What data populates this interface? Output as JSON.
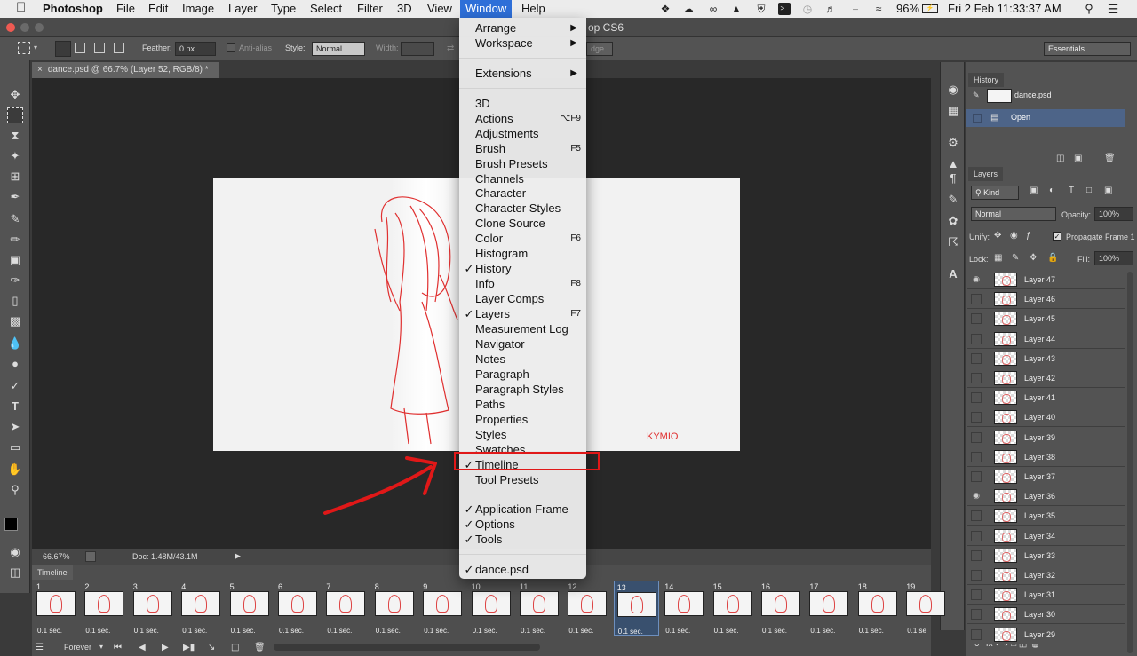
{
  "menubar": {
    "app_name": "Photoshop",
    "items": [
      "File",
      "Edit",
      "Image",
      "Layer",
      "Type",
      "Select",
      "Filter",
      "3D",
      "View",
      "Window",
      "Help"
    ],
    "active": "Window",
    "battery": "96%",
    "clock": "Fri 2 Feb  11:33:37 AM"
  },
  "window_title": "op CS6",
  "options": {
    "feather_label": "Feather:",
    "feather_value": "0 px",
    "antialias_label": "Anti-alias",
    "style_label": "Style:",
    "style_value": "Normal",
    "width_label": "Width:",
    "refine_edge": "dge...",
    "workspace": "Essentials"
  },
  "document": {
    "tab_title": "dance.psd @ 66.7% (Layer 52, RGB/8) *",
    "zoom": "66.67%",
    "doc_info": "Doc: 1.48M/43.1M",
    "signature": "KYMIO"
  },
  "window_menu": {
    "groups": [
      [
        {
          "label": "Arrange",
          "submenu": true
        },
        {
          "label": "Workspace",
          "submenu": true
        }
      ],
      [
        {
          "label": "Extensions",
          "submenu": true
        }
      ],
      [
        {
          "label": "3D"
        },
        {
          "label": "Actions",
          "shortcut": "⌥F9"
        },
        {
          "label": "Adjustments"
        },
        {
          "label": "Brush",
          "shortcut": "F5"
        },
        {
          "label": "Brush Presets"
        },
        {
          "label": "Channels"
        },
        {
          "label": "Character"
        },
        {
          "label": "Character Styles"
        },
        {
          "label": "Clone Source"
        },
        {
          "label": "Color",
          "shortcut": "F6"
        },
        {
          "label": "Histogram"
        },
        {
          "label": "History",
          "checked": true
        },
        {
          "label": "Info",
          "shortcut": "F8"
        },
        {
          "label": "Layer Comps"
        },
        {
          "label": "Layers",
          "checked": true,
          "shortcut": "F7"
        },
        {
          "label": "Measurement Log"
        },
        {
          "label": "Navigator"
        },
        {
          "label": "Notes"
        },
        {
          "label": "Paragraph"
        },
        {
          "label": "Paragraph Styles"
        },
        {
          "label": "Paths"
        },
        {
          "label": "Properties"
        },
        {
          "label": "Styles"
        },
        {
          "label": "Swatches"
        },
        {
          "label": "Timeline",
          "checked": true
        },
        {
          "label": "Tool Presets"
        }
      ],
      [
        {
          "label": "Application Frame",
          "checked": true
        },
        {
          "label": "Options",
          "checked": true
        },
        {
          "label": "Tools",
          "checked": true
        }
      ],
      [
        {
          "label": "dance.psd",
          "checked": true
        }
      ]
    ],
    "highlighted": "Timeline"
  },
  "history_panel": {
    "title": "History",
    "snapshot": "dance.psd",
    "items": [
      "Open"
    ]
  },
  "layers_panel": {
    "title": "Layers",
    "kind": "Kind",
    "blend_mode": "Normal",
    "opacity_label": "Opacity:",
    "opacity": "100%",
    "unify_label": "Unify:",
    "propagate": "Propagate Frame 1",
    "lock_label": "Lock:",
    "fill_label": "Fill:",
    "fill": "100%",
    "layers": [
      {
        "name": "Layer 47",
        "visible": true
      },
      {
        "name": "Layer 46",
        "visible": false
      },
      {
        "name": "Layer 45",
        "visible": false
      },
      {
        "name": "Layer 44",
        "visible": false
      },
      {
        "name": "Layer 43",
        "visible": false
      },
      {
        "name": "Layer 42",
        "visible": false
      },
      {
        "name": "Layer 41",
        "visible": false
      },
      {
        "name": "Layer 40",
        "visible": false
      },
      {
        "name": "Layer 39",
        "visible": false
      },
      {
        "name": "Layer 38",
        "visible": false
      },
      {
        "name": "Layer 37",
        "visible": false
      },
      {
        "name": "Layer 36",
        "visible": true
      },
      {
        "name": "Layer 35",
        "visible": false
      },
      {
        "name": "Layer 34",
        "visible": false
      },
      {
        "name": "Layer 33",
        "visible": false
      },
      {
        "name": "Layer 32",
        "visible": false
      },
      {
        "name": "Layer 31",
        "visible": false
      },
      {
        "name": "Layer 30",
        "visible": false
      },
      {
        "name": "Layer 29",
        "visible": false
      }
    ]
  },
  "timeline": {
    "title": "Timeline",
    "loop": "Forever",
    "selected_frame": 13,
    "frames": [
      {
        "n": "1",
        "t": "0.1 sec."
      },
      {
        "n": "2",
        "t": "0.1 sec."
      },
      {
        "n": "3",
        "t": "0.1 sec."
      },
      {
        "n": "4",
        "t": "0.1 sec."
      },
      {
        "n": "5",
        "t": "0.1 sec."
      },
      {
        "n": "6",
        "t": "0.1 sec."
      },
      {
        "n": "7",
        "t": "0.1 sec."
      },
      {
        "n": "8",
        "t": "0.1 sec."
      },
      {
        "n": "9",
        "t": "0.1 sec."
      },
      {
        "n": "10",
        "t": "0.1 sec."
      },
      {
        "n": "11",
        "t": "0.1 sec."
      },
      {
        "n": "12",
        "t": "0.1 sec."
      },
      {
        "n": "13",
        "t": "0.1 sec."
      },
      {
        "n": "14",
        "t": "0.1 sec."
      },
      {
        "n": "15",
        "t": "0.1 sec."
      },
      {
        "n": "16",
        "t": "0.1 sec."
      },
      {
        "n": "17",
        "t": "0.1 sec."
      },
      {
        "n": "18",
        "t": "0.1 sec."
      },
      {
        "n": "19",
        "t": "0.1 se"
      }
    ]
  },
  "colors": {
    "accent": "#2e6fd8",
    "highlight_box": "#e01818",
    "annotation": "#e01818",
    "selected_frame": "#39506e"
  }
}
